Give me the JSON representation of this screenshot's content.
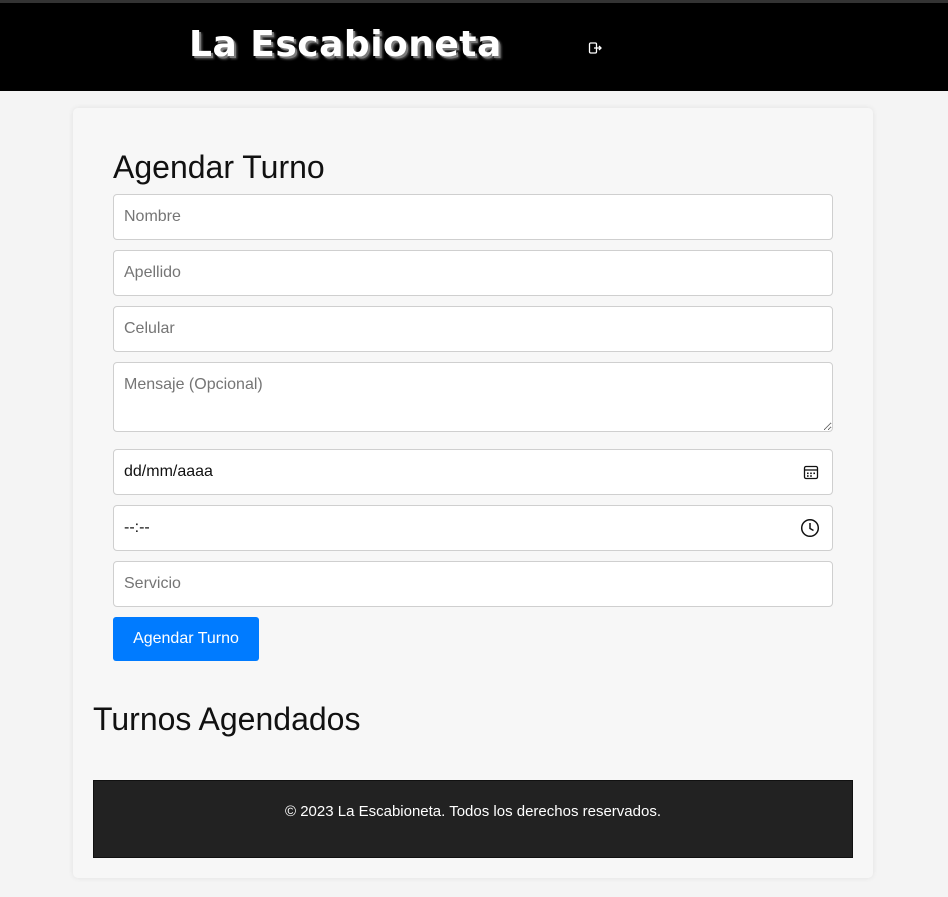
{
  "header": {
    "brand": "La Escabioneta",
    "logout_icon": "logout-icon"
  },
  "form": {
    "title": "Agendar Turno",
    "nombre_placeholder": "Nombre",
    "apellido_placeholder": "Apellido",
    "celular_placeholder": "Celular",
    "mensaje_placeholder": "Mensaje (Opcional)",
    "fecha_value": "dd/mm/aaaa",
    "fecha_icon": "calendar-icon",
    "hora_value": "--:--",
    "hora_icon": "clock-icon",
    "servicio_placeholder": "Servicio",
    "submit_label": "Agendar Turno"
  },
  "turnos": {
    "title": "Turnos Agendados"
  },
  "footer": {
    "text": "© 2023 La Escabioneta. Todos los derechos reservados."
  },
  "colors": {
    "header_bg": "#000000",
    "primary": "#007bff",
    "footer_bg": "#222222"
  }
}
